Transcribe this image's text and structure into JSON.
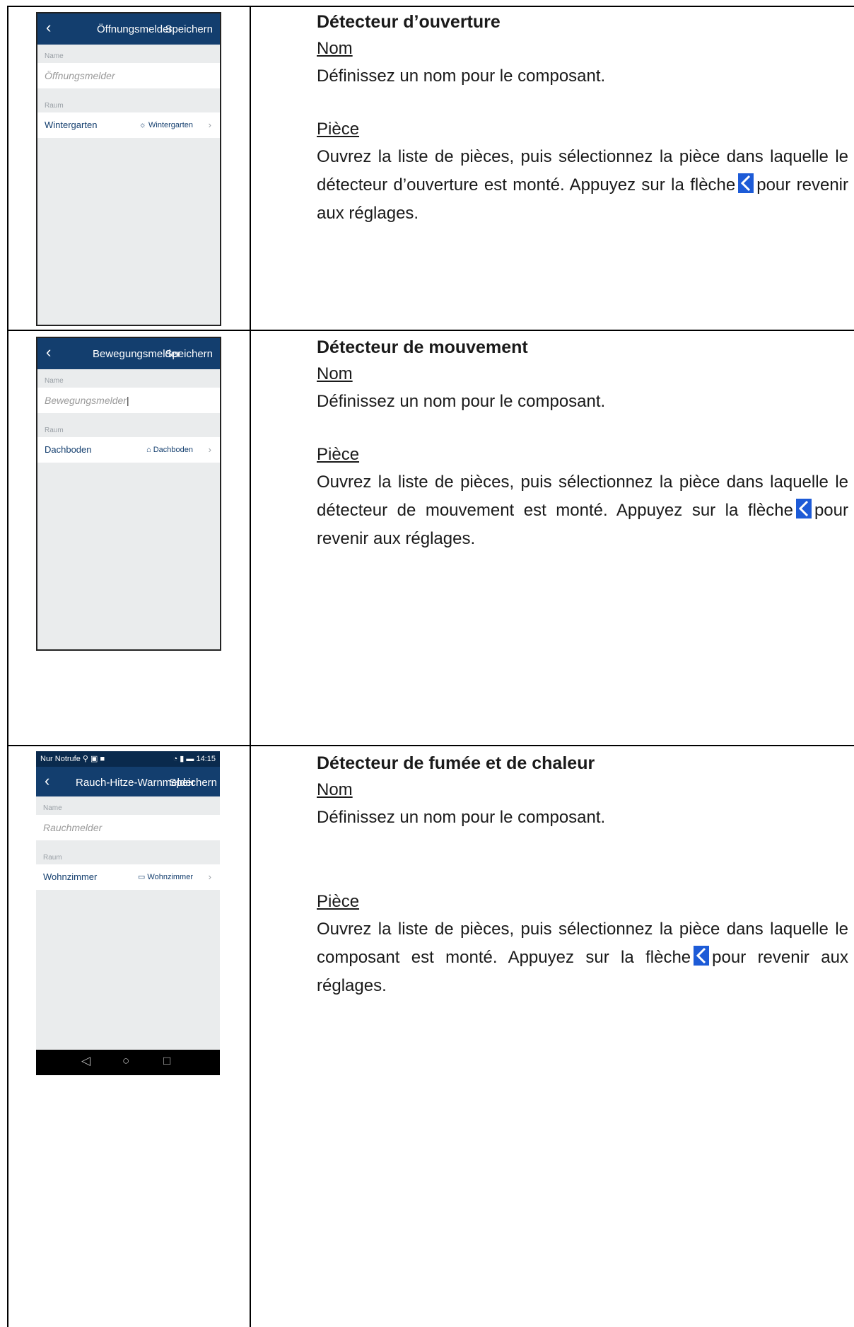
{
  "sections": [
    {
      "title": "Détecteur d’ouverture",
      "nom_label": "Nom",
      "nom_text": "Définissez un nom pour le composant.",
      "piece_label": "Pièce",
      "piece_text_before": "Ouvrez la liste de pièces, puis sélectionnez la pièce dans laquelle le détecteur d’ouverture est monté. Appuyez sur la flèche",
      "piece_text_after": "pour revenir aux réglages.",
      "phone": {
        "title": "Öffnungsmelder",
        "save": "Speichern",
        "name_label": "Name",
        "name_value": "Öffnungsmelder",
        "room_label": "Raum",
        "room_row": "Wintergarten",
        "room_value": "Wintergarten",
        "room_icon": "sun-room-icon"
      }
    },
    {
      "title": "Détecteur de mouvement",
      "nom_label": "Nom",
      "nom_text": "Définissez un nom pour le composant.",
      "piece_label": "Pièce",
      "piece_text_before": "Ouvrez la liste de pièces, puis sélectionnez la pièce dans laquelle le détecteur de mouvement est monté. Appuyez sur la flèche",
      "piece_text_after": "pour revenir aux réglages.",
      "phone": {
        "title": "Bewegungsmelder",
        "save": "Speichern",
        "name_label": "Name",
        "name_value": "Bewegungsmelder",
        "room_label": "Raum",
        "room_row": "Dachboden",
        "room_value": "Dachboden",
        "room_icon": "attic-icon"
      }
    },
    {
      "title": "Détecteur de fumée et de chaleur",
      "nom_label": "Nom",
      "nom_text": "Définissez un nom pour le composant.",
      "piece_label": "Pièce",
      "piece_text_before": "Ouvrez la liste de pièces, puis sélectionnez la pièce dans laquelle le composant est monté. Appuyez sur la flèche",
      "piece_text_after": "pour revenir aux réglages.",
      "phone": {
        "status_left": "Nur Notrufe",
        "status_time": "14:15",
        "title": "Rauch-Hitze-Warnmelder",
        "save": "Speichern",
        "name_label": "Name",
        "name_value": "Rauchmelder",
        "room_label": "Raum",
        "room_row": "Wohnzimmer",
        "room_value": "Wohnzimmer",
        "room_icon": "sofa-icon"
      }
    }
  ],
  "colors": {
    "app_bar": "#133e6e",
    "arrow_icon": "#1d5bd7"
  }
}
